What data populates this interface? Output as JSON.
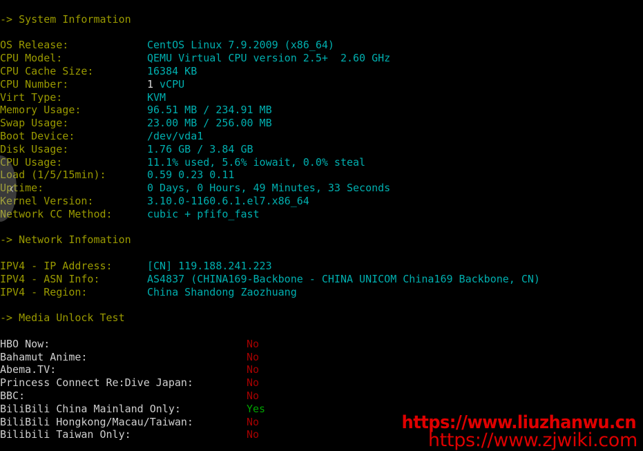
{
  "terminal": {
    "background": "#000000",
    "label_color": "#9a9a00",
    "value_color": "#00afaf",
    "media_label_color": "#d0d0d0",
    "no_color": "#a50000",
    "yes_color": "#00a400"
  },
  "sections": {
    "system": {
      "heading": "-> System Information",
      "rows": [
        {
          "label": "OS Release:",
          "value": "CentOS Linux 7.9.2009 (x86_64)"
        },
        {
          "label": "CPU Model:",
          "value": "QEMU Virtual CPU version 2.5+  2.60 GHz"
        },
        {
          "label": "CPU Cache Size:",
          "value": "16384 KB"
        },
        {
          "label": "CPU Number:",
          "value_white": "1",
          "value": " vCPU"
        },
        {
          "label": "Virt Type:",
          "value": "KVM"
        },
        {
          "label": "Memory Usage:",
          "value": "96.51 MB / 234.91 MB"
        },
        {
          "label": "Swap Usage:",
          "value": "23.00 MB / 256.00 MB"
        },
        {
          "label": "Boot Device:",
          "value": "/dev/vda1"
        },
        {
          "label": "Disk Usage:",
          "value": "1.76 GB / 3.84 GB"
        },
        {
          "label": "CPU Usage:",
          "value": "11.1% used, 5.6% iowait, 0.0% steal"
        },
        {
          "label": "Load (1/5/15min):",
          "value": "0.59 0.23 0.11"
        },
        {
          "label": "Uptime:",
          "value": "0 Days, 0 Hours, 49 Minutes, 33 Seconds"
        },
        {
          "label": "Kernel Version:",
          "value": "3.10.0-1160.6.1.el7.x86_64"
        },
        {
          "label": "Network CC Method:",
          "value": "cubic + pfifo_fast"
        }
      ]
    },
    "network": {
      "heading": "-> Network Infomation",
      "rows": [
        {
          "label": "IPV4 - IP Address:",
          "value": "[CN] 119.188.241.223"
        },
        {
          "label": "IPV4 - ASN Info:",
          "value": "AS4837 (CHINA169-Backbone - CHINA UNICOM China169 Backbone, CN)"
        },
        {
          "label": "IPV4 - Region:",
          "value": "China Shandong Zaozhuang"
        }
      ]
    },
    "media": {
      "heading": "-> Media Unlock Test",
      "rows": [
        {
          "label": "HBO Now:",
          "value": "No",
          "state": "no"
        },
        {
          "label": "Bahamut Anime:",
          "value": "No",
          "state": "no"
        },
        {
          "label": "Abema.TV:",
          "value": "No",
          "state": "no"
        },
        {
          "label": "Princess Connect Re:Dive Japan:",
          "value": "No",
          "state": "no"
        },
        {
          "label": "BBC:",
          "value": "No",
          "state": "no"
        },
        {
          "label": "BiliBili China Mainland Only:",
          "value": "Yes",
          "state": "yes"
        },
        {
          "label": "BiliBili Hongkong/Macau/Taiwan:",
          "value": "No",
          "state": "no"
        },
        {
          "label": "Bilibili Taiwan Only:",
          "value": "No",
          "state": "no"
        }
      ]
    }
  },
  "edge_nav": {
    "icon": "‹"
  },
  "watermarks": {
    "primary": "https://www.liuzhanwu.cn",
    "secondary": "https://www.zjwiki.com",
    "color": "#dd0000"
  }
}
